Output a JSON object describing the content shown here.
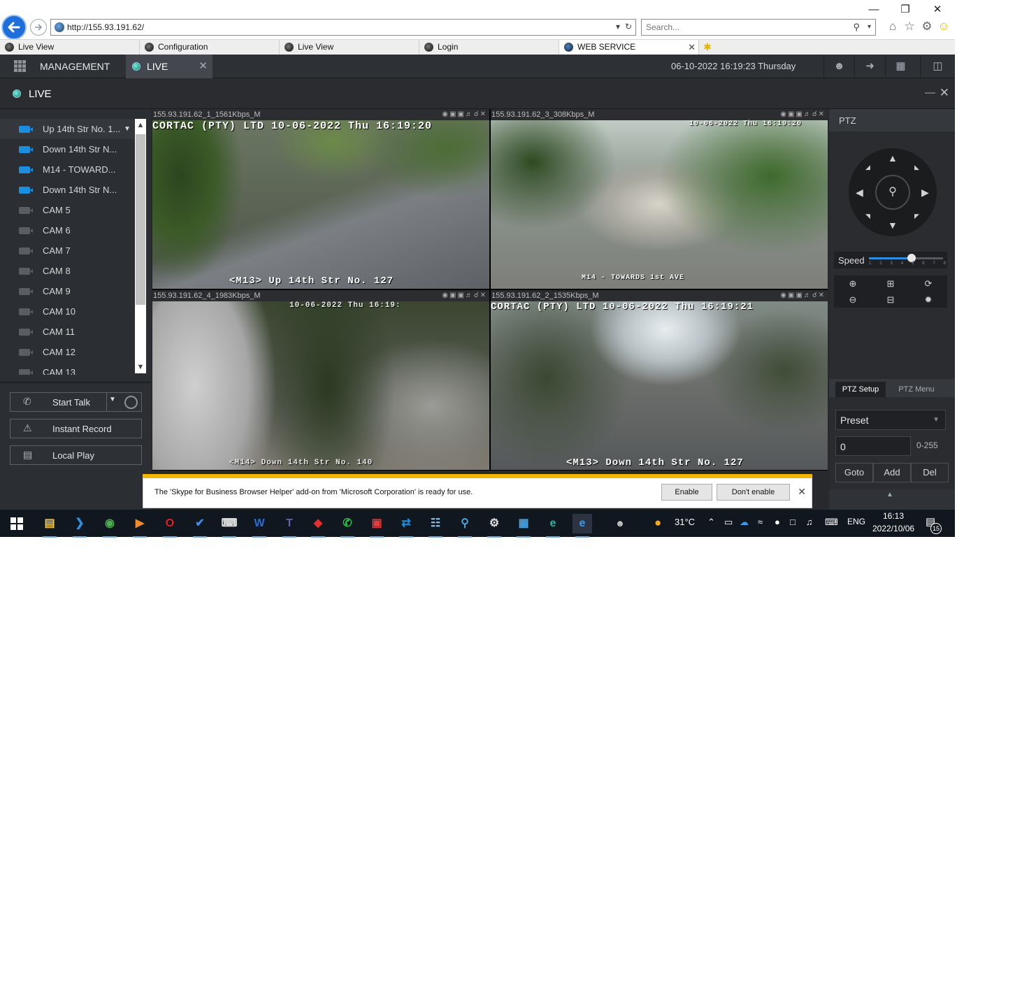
{
  "browser": {
    "url": "http://155.93.191.62/",
    "search_placeholder": "Search...",
    "tabs": [
      {
        "label": "Live View"
      },
      {
        "label": "Configuration"
      },
      {
        "label": "Live View"
      },
      {
        "label": "Login"
      },
      {
        "label": "WEB SERVICE"
      }
    ]
  },
  "app": {
    "management_label": "MANAGEMENT",
    "live_tab_label": "LIVE",
    "datetime": "06-10-2022 16:19:23 Thursday",
    "window_title": "LIVE"
  },
  "cameras": [
    {
      "label": "Up 14th Str No. 1...",
      "active": true
    },
    {
      "label": "Down 14th Str N...",
      "active": true
    },
    {
      "label": "M14 - TOWARD...",
      "active": true
    },
    {
      "label": "Down 14th Str N...",
      "active": true
    },
    {
      "label": "CAM 5",
      "active": false
    },
    {
      "label": "CAM 6",
      "active": false
    },
    {
      "label": "CAM 7",
      "active": false
    },
    {
      "label": "CAM 8",
      "active": false
    },
    {
      "label": "CAM 9",
      "active": false
    },
    {
      "label": "CAM 10",
      "active": false
    },
    {
      "label": "CAM 11",
      "active": false
    },
    {
      "label": "CAM 12",
      "active": false
    },
    {
      "label": "CAM 13",
      "active": false
    }
  ],
  "left_buttons": {
    "start_talk": "Start Talk",
    "instant_record": "Instant Record",
    "local_play": "Local Play"
  },
  "video": [
    {
      "header": "155.93.191.62_1_1561Kbps_M",
      "osd_top": "CORTAC (PTY) LTD  10-06-2022 Thu 16:19:20",
      "osd_bottom": "<M13> Up 14th Str No. 127"
    },
    {
      "header": "155.93.191.62_3_308Kbps_M",
      "osd_top": "10-06-2022 Thu 16:19:20",
      "osd_bottom": "M14 - TOWARDS 1st AVE"
    },
    {
      "header": "155.93.191.62_4_1983Kbps_M",
      "osd_top": "10-06-2022 Thu 16:19:",
      "osd_bottom": "<M14> Down 14th Str No. 140"
    },
    {
      "header": "155.93.191.62_2_1535Kbps_M",
      "osd_top": "CORTAC (PTY) LTD  10-06-2022 Thu 16:19:21",
      "osd_bottom": "<M13> Down 14th Str  No. 127"
    }
  ],
  "ptz": {
    "title": "PTZ",
    "speed_label": "Speed",
    "speed_value": 5,
    "speed_ticks": [
      "1",
      "2",
      "3",
      "4",
      "5",
      "6",
      "7",
      "8"
    ],
    "tab_setup": "PTZ Setup",
    "tab_menu": "PTZ Menu",
    "preset_label": "Preset",
    "preset_number": "0",
    "range": "0-255",
    "goto": "Goto",
    "add": "Add",
    "del": "Del"
  },
  "notification": {
    "message": "The 'Skype for Business Browser Helper' add-on from 'Microsoft Corporation' is ready for use.",
    "enable": "Enable",
    "dont_enable": "Don't enable"
  },
  "taskbar": {
    "weather": "31°C",
    "language": "ENG",
    "time": "16:13",
    "date": "2022/10/06",
    "notifications": "15"
  }
}
